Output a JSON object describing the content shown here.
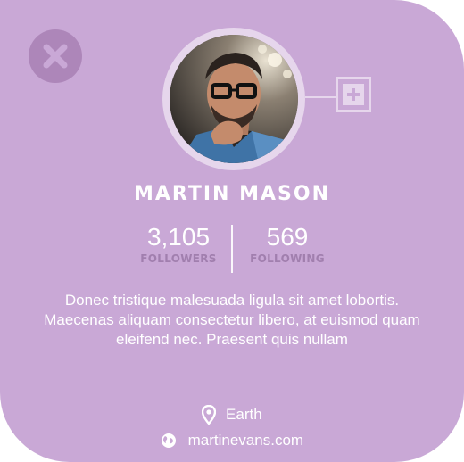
{
  "profile": {
    "name": "MARTIN MASON",
    "followers": {
      "value": "3,105",
      "label": "FOLLOWERS"
    },
    "following": {
      "value": "569",
      "label": "FOLLOWING"
    },
    "bio": "Donec tristique malesuada ligula sit amet lobortis. Maecenas aliquam consectetur libero, at euismod quam eleifend nec. Praesent quis nullam",
    "location": "Earth",
    "website": "martinevans.com"
  },
  "icons": {
    "close": "close-icon",
    "add": "plus-icon",
    "location": "map-pin-icon",
    "website": "globe-icon"
  },
  "colors": {
    "card_background": "#c9a8d6",
    "close_button": "#ad86b9",
    "accent_light": "#e6d6ec",
    "label_muted": "#a17fae",
    "text": "#ffffff"
  }
}
